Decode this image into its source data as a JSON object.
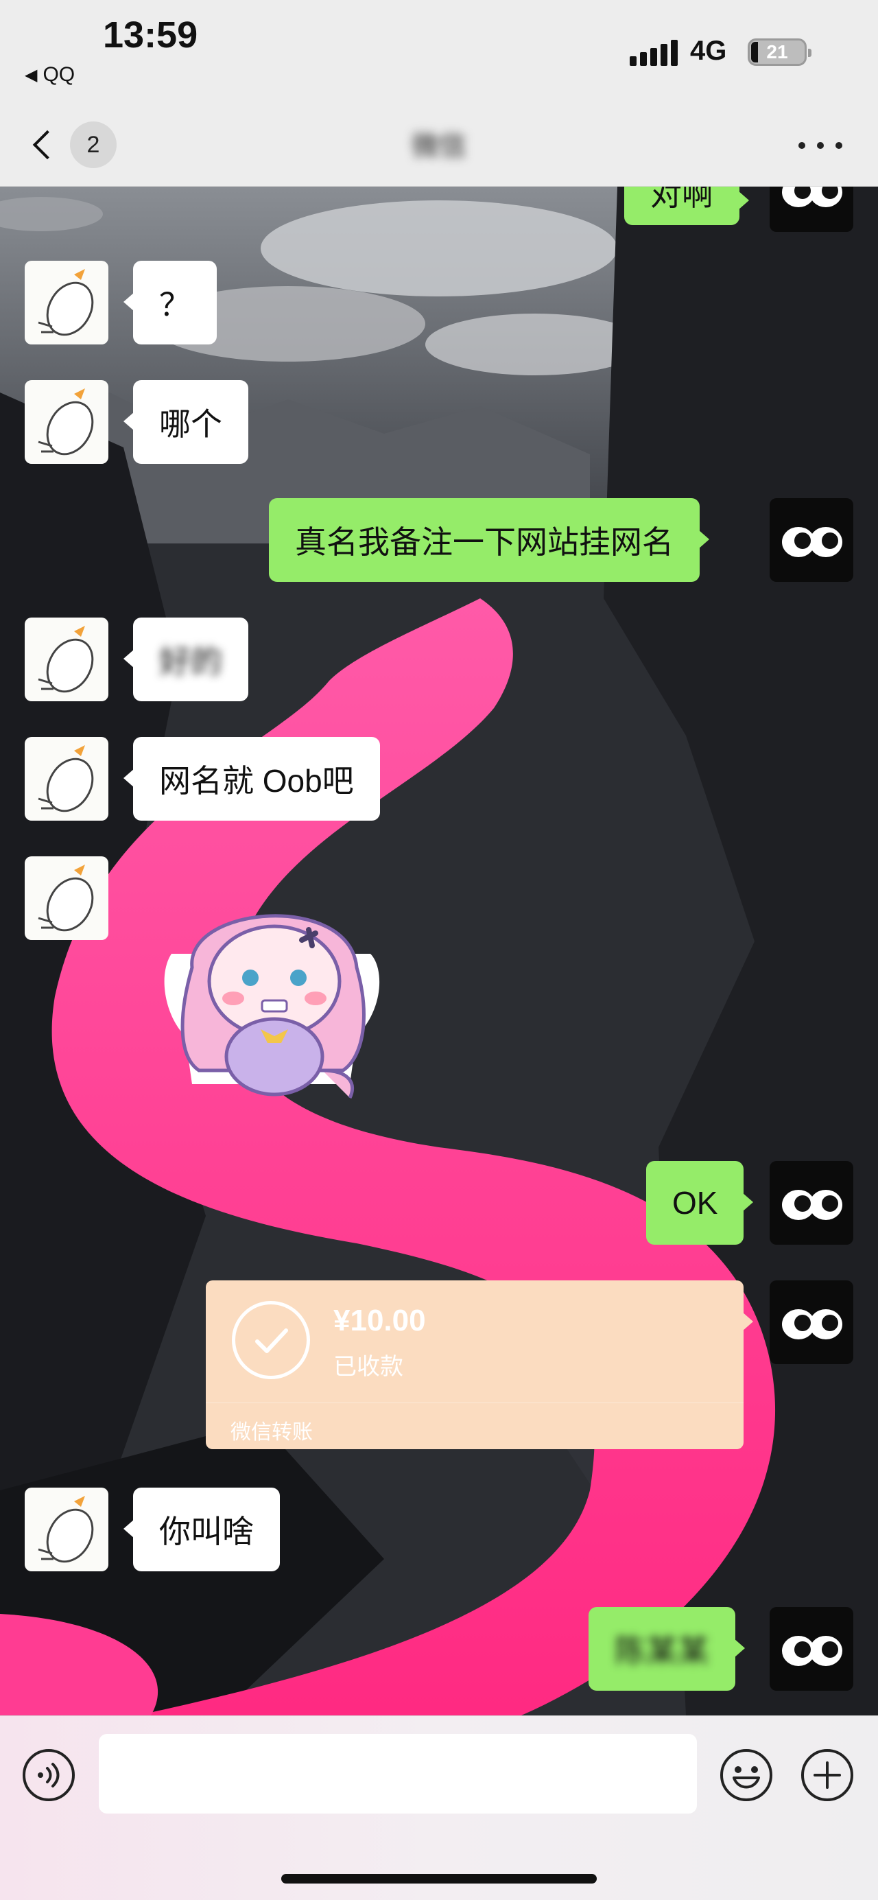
{
  "status_bar": {
    "time": "13:59",
    "back_app": "QQ",
    "network": "4G",
    "battery": "21"
  },
  "nav": {
    "unread_count": "2",
    "title": "微信",
    "icons": {
      "back": "chevron-left-icon",
      "more": "more-dots-icon"
    }
  },
  "messages": [
    {
      "sender": "me",
      "text": "对啊"
    },
    {
      "sender": "them",
      "text": "？"
    },
    {
      "sender": "them",
      "text": "哪个"
    },
    {
      "sender": "me",
      "text": "真名我备注一下网站挂网名"
    },
    {
      "sender": "them",
      "text": "好的"
    },
    {
      "sender": "them",
      "text": "网名就 Oob吧"
    },
    {
      "sender": "them",
      "type": "sticker",
      "text": ""
    },
    {
      "sender": "me",
      "text": "OK"
    },
    {
      "sender": "me",
      "type": "transfer",
      "amount": "¥10.00",
      "status": "已收款",
      "label": "微信转账"
    },
    {
      "sender": "them",
      "text": "你叫啥"
    },
    {
      "sender": "me",
      "text": "陈某某"
    }
  ],
  "input_bar": {
    "placeholder": "",
    "icons": {
      "voice": "voice-icon",
      "emoji": "emoji-icon",
      "plus": "plus-icon"
    }
  },
  "colors": {
    "my_bubble": "#95ec69",
    "their_bubble": "#ffffff",
    "transfer_card": "#fbdcc0",
    "lava": "#ff2f8a"
  }
}
